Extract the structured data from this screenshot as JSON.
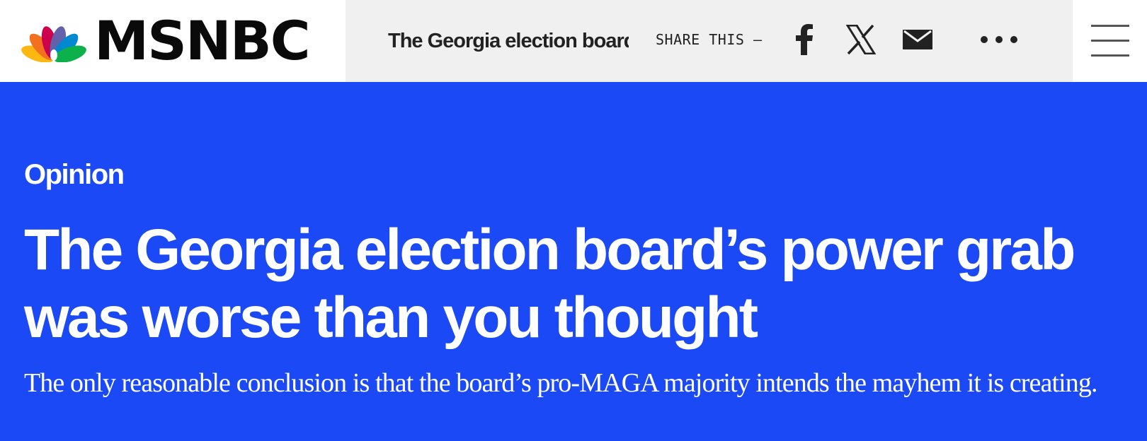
{
  "header": {
    "brand": "MSNBC",
    "story_title": "The Georgia election board",
    "share_label": "SHARE THIS —",
    "share_icons": [
      "facebook-icon",
      "x-icon",
      "email-icon",
      "more-icon"
    ],
    "menu_icon": "hamburger-menu-icon"
  },
  "article": {
    "label": "Opinion",
    "headline": "The Georgia election board’s power grab was worse than you thought",
    "dek": "The only reasonable conclusion is that the board’s pro-MAGA majority intends the mayhem it is creating."
  },
  "colors": {
    "hero_background": "#1a49f5",
    "share_bar_background": "#f0f0f0",
    "text_on_hero": "#ffffff",
    "brand_text": "#0a0a0a",
    "peacock": [
      "#fcb711",
      "#f37021",
      "#cc004c",
      "#6460aa",
      "#0089d0",
      "#0db14b"
    ]
  }
}
